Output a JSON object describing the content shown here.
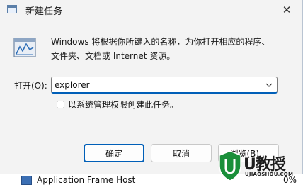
{
  "dialog": {
    "title": "新建任务",
    "close_glyph": "✕",
    "icon": "run-icon",
    "description_line1": "Windows 将根据你所键入的名称，为你打开相应的程序、",
    "description_line2": "文件夹、文档或 Internet 资源。",
    "open_label": "打开(O):",
    "open_value": "explorer",
    "admin_label": "以系统管理权限创建此任务。",
    "admin_checked": false,
    "buttons": {
      "ok": "确定",
      "cancel": "取消",
      "browse": "浏览(B)..."
    }
  },
  "background": {
    "row_text": "Application Frame Host",
    "row_pct": "0%"
  },
  "watermark": {
    "logo_text": "U教授",
    "site": "UJIAOSHOU.COM"
  },
  "colors": {
    "accent": "#005fb8",
    "watermark_green": "#1a8f3a"
  }
}
